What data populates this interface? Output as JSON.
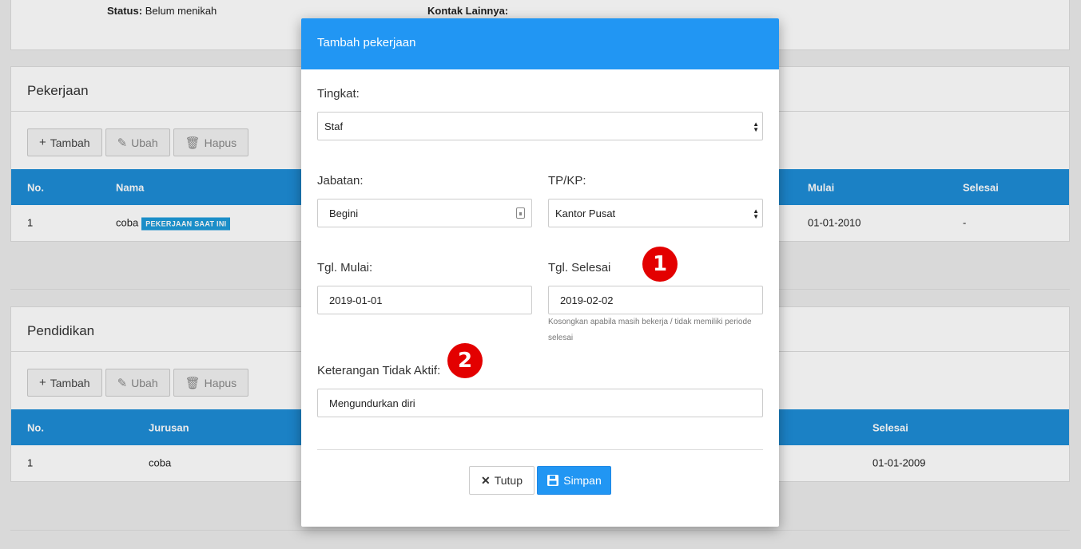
{
  "profile": {
    "status_label": "Status:",
    "status_value": "Belum menikah",
    "contact_label": "Kontak Lainnya:"
  },
  "sections": {
    "pekerjaan": {
      "title": "Pekerjaan",
      "toolbar": {
        "add": "Tambah",
        "edit": "Ubah",
        "delete": "Hapus"
      },
      "columns": {
        "no": "No.",
        "nama": "Nama",
        "mulai": "Mulai",
        "selesai": "Selesai"
      },
      "row": {
        "no": "1",
        "nama": "coba",
        "badge": "PEKERJAAN SAAT INI",
        "mulai": "01-01-2010",
        "selesai": "-"
      }
    },
    "pendidikan": {
      "title": "Pendidikan",
      "toolbar": {
        "add": "Tambah",
        "edit": "Ubah",
        "delete": "Hapus"
      },
      "columns": {
        "no": "No.",
        "jurusan": "Jurusan",
        "selesai": "Selesai"
      },
      "row": {
        "no": "1",
        "jurusan": "coba",
        "selesai": "01-01-2009"
      }
    }
  },
  "modal": {
    "title": "Tambah pekerjaan",
    "tingkat": {
      "label": "Tingkat:",
      "value": "Staf"
    },
    "jabatan": {
      "label": "Jabatan:",
      "value": "Begini"
    },
    "tpkp": {
      "label": "TP/KP:",
      "value": "Kantor Pusat"
    },
    "tgl_mulai": {
      "label": "Tgl. Mulai:",
      "value": "2019-01-01"
    },
    "tgl_selesai": {
      "label": "Tgl. Selesai",
      "value": "2019-02-02",
      "help": "Kosongkan apabila masih bekerja / tidak memiliki periode selesai"
    },
    "keterangan": {
      "label": "Keterangan Tidak Aktif:",
      "value": "Mengundurkan diri"
    },
    "buttons": {
      "close": "Tutup",
      "save": "Simpan"
    }
  },
  "annotations": {
    "marker_1": "1",
    "marker_2": "2",
    "color": "#e30000"
  },
  "colors": {
    "primary": "#2196f3",
    "table_header": "#1e8cd6",
    "badge": "#1e9bd9"
  },
  "icons": [
    "plus-icon",
    "edit-icon",
    "trash-icon",
    "close-icon",
    "save-icon",
    "caret-updown-icon",
    "keyboard-icon"
  ]
}
